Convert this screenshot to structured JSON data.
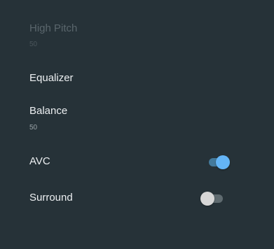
{
  "settings": {
    "high_pitch": {
      "title": "High Pitch",
      "value": "50",
      "enabled": false
    },
    "equalizer": {
      "title": "Equalizer"
    },
    "balance": {
      "title": "Balance",
      "value": "50"
    },
    "avc": {
      "title": "AVC",
      "on": true
    },
    "surround": {
      "title": "Surround",
      "on": false
    }
  },
  "colors": {
    "background": "#263238",
    "accent": "#64b5f6",
    "accent_track": "#447a9c",
    "switch_off_thumb": "#d7d7d7",
    "switch_off_track": "#5f6b70"
  }
}
